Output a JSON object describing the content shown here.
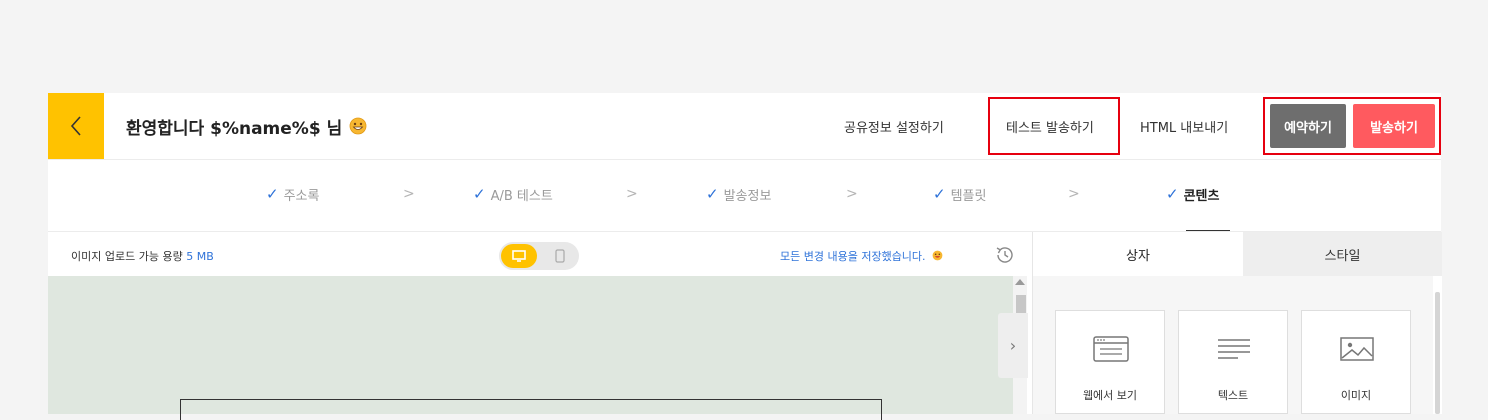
{
  "header": {
    "title": "환영합니다 $%name%$ 님",
    "title_emoji": "grinning-face-emoji",
    "share_settings": "공유정보 설정하기",
    "test_send": "테스트 발송하기",
    "html_export": "HTML 내보내기",
    "schedule": "예약하기",
    "send": "발송하기"
  },
  "steps": [
    {
      "label": "주소록",
      "done": true
    },
    {
      "label": "A/B 테스트",
      "done": true
    },
    {
      "label": "발송정보",
      "done": true
    },
    {
      "label": "템플릿",
      "done": true
    },
    {
      "label": "콘텐츠",
      "done": true,
      "active": true
    }
  ],
  "editor": {
    "upload_label": "이미지 업로드 가능 용량",
    "upload_size": "5 MB",
    "saved_message": "모든 변경 내용을 저장했습니다.",
    "view_mode": "desktop"
  },
  "panel": {
    "tabs": [
      "상자",
      "스타일"
    ],
    "selected_tab": "상자",
    "blocks": [
      {
        "label": "웹에서 보기",
        "icon": "browser-window-icon"
      },
      {
        "label": "텍스트",
        "icon": "text-lines-icon"
      },
      {
        "label": "이미지",
        "icon": "image-icon"
      }
    ]
  },
  "colors": {
    "accent_yellow": "#ffc200",
    "send_red": "#ff5a5f",
    "schedule_gray": "#6e6e6e",
    "highlight_red": "#e6000f",
    "link_blue": "#2f73d9",
    "canvas_green": "#dfe7df"
  }
}
